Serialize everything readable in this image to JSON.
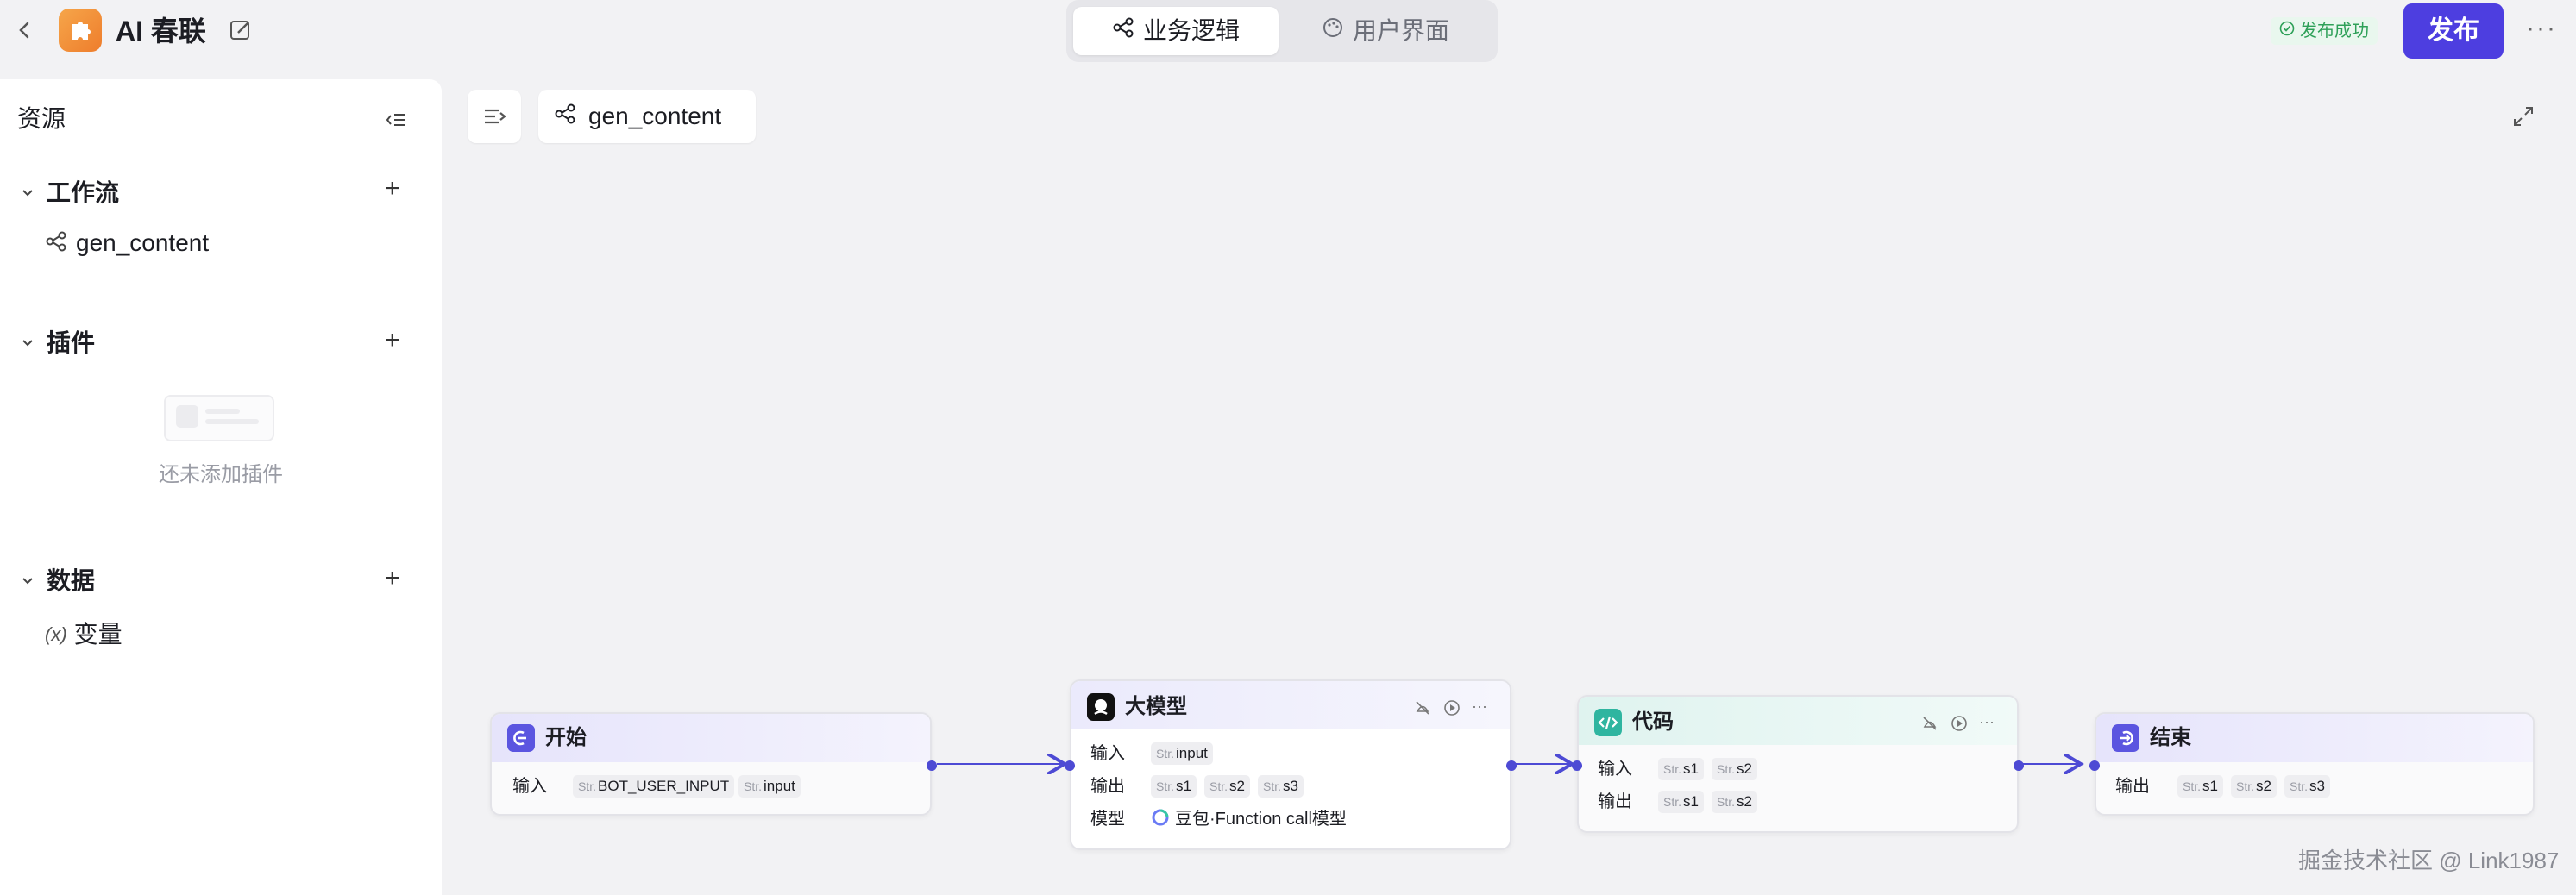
{
  "app": {
    "title": "AI 春联",
    "tabs": [
      "业务逻辑",
      "用户界面"
    ],
    "publish_status": "发布成功",
    "publish_label": "发布",
    "accent_color": "#4d3ee0"
  },
  "sidebar": {
    "title": "资源",
    "sections": [
      {
        "label": "工作流",
        "items": [
          "gen_content"
        ]
      },
      {
        "label": "插件",
        "empty_text": "还未添加插件"
      },
      {
        "label": "数据",
        "items": [
          "变量"
        ]
      }
    ]
  },
  "canvas": {
    "workflow_tab": "gen_content",
    "nodes": {
      "start": {
        "title": "开始",
        "input_label": "输入",
        "inputs": [
          {
            "type": "Str.",
            "name": "BOT_USER_INPUT"
          },
          {
            "type": "Str.",
            "name": "input"
          }
        ]
      },
      "llm": {
        "title": "大模型",
        "input_label": "输入",
        "output_label": "输出",
        "model_label": "模型",
        "inputs": [
          {
            "type": "Str.",
            "name": "input"
          }
        ],
        "outputs": [
          {
            "type": "Str.",
            "name": "s1"
          },
          {
            "type": "Str.",
            "name": "s2"
          },
          {
            "type": "Str.",
            "name": "s3"
          }
        ],
        "model": "豆包·Function call模型"
      },
      "code": {
        "title": "代码",
        "input_label": "输入",
        "output_label": "输出",
        "inputs": [
          {
            "type": "Str.",
            "name": "s1"
          },
          {
            "type": "Str.",
            "name": "s2"
          }
        ],
        "outputs": [
          {
            "type": "Str.",
            "name": "s1"
          },
          {
            "type": "Str.",
            "name": "s2"
          }
        ]
      },
      "end": {
        "title": "结束",
        "output_label": "输出",
        "outputs": [
          {
            "type": "Str.",
            "name": "s1"
          },
          {
            "type": "Str.",
            "name": "s2"
          },
          {
            "type": "Str.",
            "name": "s3"
          }
        ]
      }
    }
  },
  "watermark": "掘金技术社区 @ Link1987"
}
